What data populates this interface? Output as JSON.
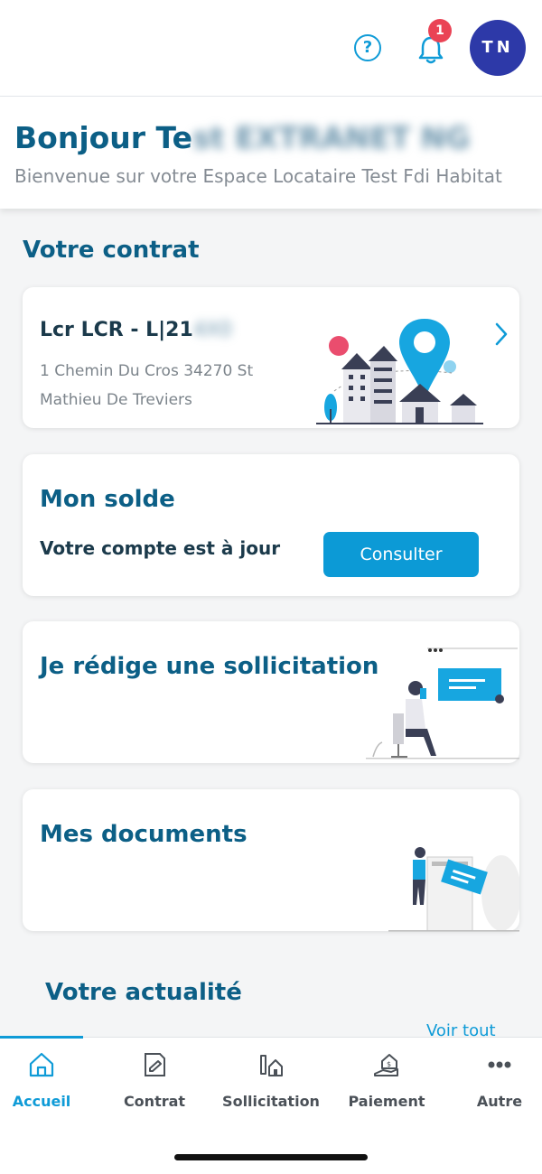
{
  "header": {
    "help_icon": "?",
    "notification_count": "1",
    "avatar_initials": "TN"
  },
  "greeting": {
    "title_visible": "Bonjour Te",
    "title_blurred": "st EXTRANET NG",
    "subtitle": "Bienvenue sur votre Espace Locataire Test Fdi Habitat"
  },
  "contract_section": {
    "title": "Votre contrat",
    "contract_ref_visible": "Lcr LCR - L|21",
    "contract_ref_blurred": "4X0",
    "address_line1": "1 Chemin Du Cros 34270 St",
    "address_line2": "Mathieu De Treviers"
  },
  "balance_card": {
    "title": "Mon solde",
    "status": "Votre compte est à jour",
    "button": "Consulter"
  },
  "request_card": {
    "title": "Je rédige une sollicitation"
  },
  "documents_card": {
    "title": "Mes documents"
  },
  "news": {
    "title": "Votre actualité",
    "see_all": "Voir tout"
  },
  "tabs": [
    {
      "label": "Accueil",
      "icon": "home-icon"
    },
    {
      "label": "Contrat",
      "icon": "contract-icon"
    },
    {
      "label": "Sollicitation",
      "icon": "request-icon"
    },
    {
      "label": "Paiement",
      "icon": "payment-icon"
    },
    {
      "label": "Autre",
      "icon": "more-icon"
    }
  ],
  "colors": {
    "primary": "#0c5f86",
    "accent": "#0f9bd7",
    "badge": "#ea4355",
    "avatar": "#2d39a8"
  }
}
